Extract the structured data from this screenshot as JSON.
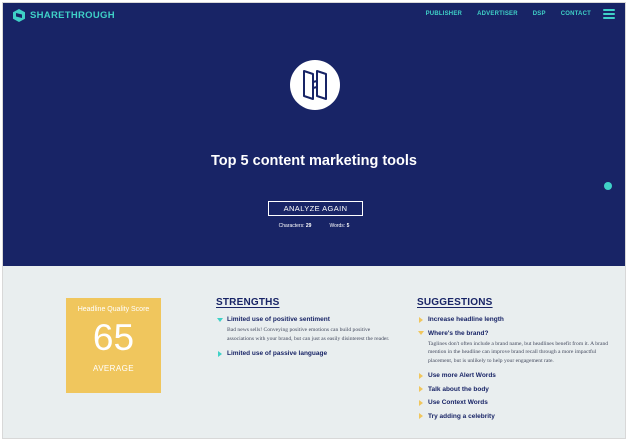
{
  "nav": {
    "brand": "SHARETHROUGH",
    "links": [
      "PUBLISHER",
      "ADVERTISER",
      "DSP",
      "CONTACT"
    ]
  },
  "hero": {
    "title": "Top 5 content marketing tools",
    "analyze_label": "ANALYZE AGAIN",
    "characters_label": "Characters:",
    "characters_value": "29",
    "words_label": "Words:",
    "words_value": "5"
  },
  "score": {
    "label": "Headline Quality Score",
    "value": "65",
    "rating": "AVERAGE"
  },
  "strengths": {
    "title": "STRENGTHS",
    "items": [
      {
        "label": "Limited use of positive sentiment",
        "description": "Bad news sells! Conveying positive emotions can build positive associations with your brand, but can just as easily disinterest the reader."
      },
      {
        "label": "Limited use of passive language"
      }
    ]
  },
  "suggestions": {
    "title": "SUGGESTIONS",
    "items": [
      {
        "label": "Increase headline length"
      },
      {
        "label": "Where's the brand?",
        "description": "Taglines don't often include a brand name, but headlines benefit from it. A brand mention in the headline can improve brand recall through a more impactful placement, but is unlikely to help your engagement rate."
      },
      {
        "label": "Use more Alert Words"
      },
      {
        "label": "Talk about the body"
      },
      {
        "label": "Use Context Words"
      },
      {
        "label": "Try adding a celebrity"
      }
    ]
  },
  "colors": {
    "navy": "#182466",
    "teal": "#3fd1c7",
    "gold": "#f0c65d",
    "panel": "#e9eeef"
  },
  "icons": {
    "logo": "hexagon-logo-icon",
    "menu": "hamburger-menu-icon",
    "emblem": "sharethrough-emblem-icon",
    "expanded": "triangle-down-icon",
    "collapsed": "triangle-right-icon"
  }
}
